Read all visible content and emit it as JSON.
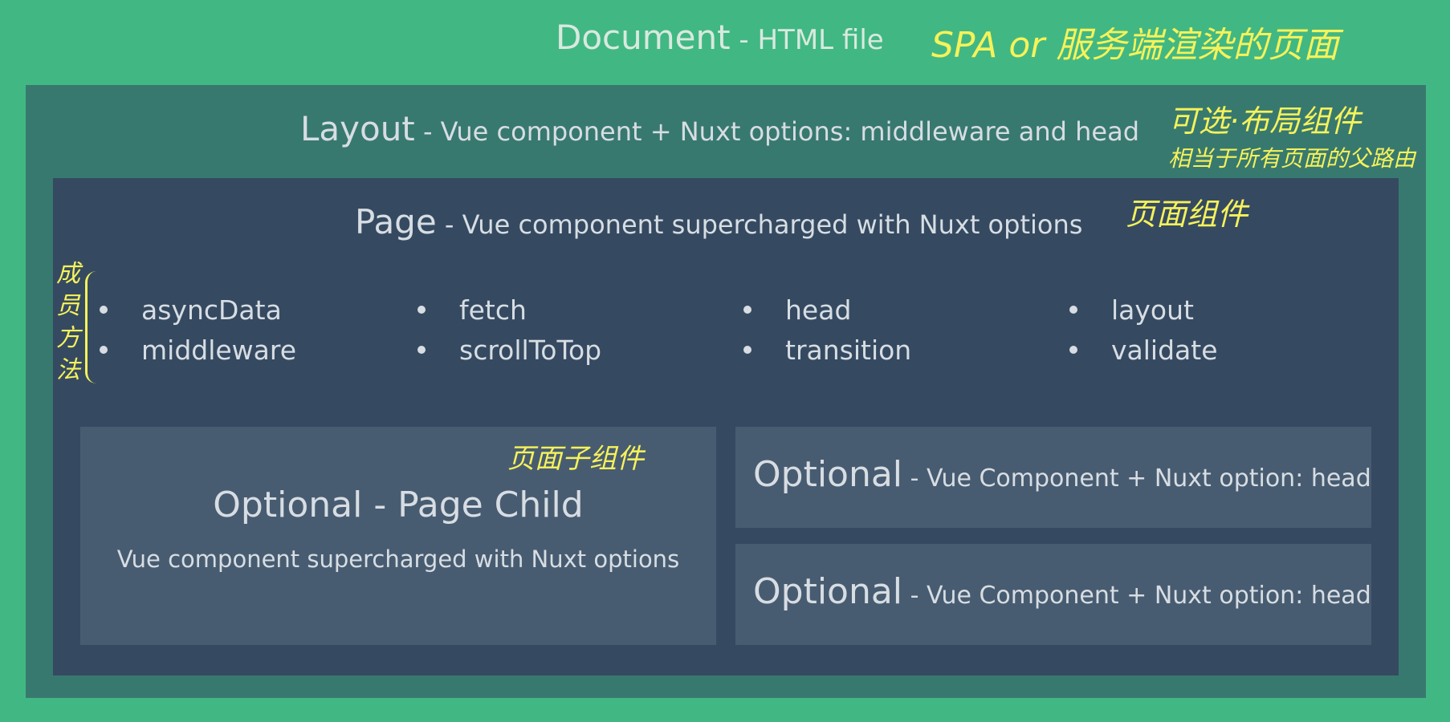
{
  "document": {
    "title": "Document",
    "dash": " - ",
    "subtitle": "HTML file",
    "annotation": "SPA  or 服务端渲染的页面"
  },
  "layout": {
    "title": "Layout",
    "dash": " - ",
    "subtitle": "Vue component + Nuxt options: middleware and head",
    "annotation_line1": "可选·布局组件",
    "annotation_line2": "相当于所有页面的父路由"
  },
  "page": {
    "title": "Page",
    "dash": " - ",
    "subtitle": "Vue component supercharged with Nuxt options",
    "annotation": "页面组件",
    "members_annotation": "成员方法",
    "options": [
      [
        "asyncData",
        "middleware"
      ],
      [
        "fetch",
        "scrollToTop"
      ],
      [
        "head",
        "transition"
      ],
      [
        "layout",
        "validate"
      ]
    ]
  },
  "page_child": {
    "title": "Optional - Page Child",
    "subtitle": "Vue component supercharged with Nuxt options",
    "annotation": "页面子组件"
  },
  "components": [
    {
      "title": "Optional",
      "dash": " - ",
      "subtitle": "Vue Component + Nuxt option: head"
    },
    {
      "title": "Optional",
      "dash": " - ",
      "subtitle": "Vue Component + Nuxt option: head"
    }
  ],
  "colors": {
    "document_bg": "#41b883",
    "layout_bg": "#38796f",
    "page_bg": "#354a61",
    "child_bg": "#485c71",
    "annotation": "#f6f25a"
  }
}
